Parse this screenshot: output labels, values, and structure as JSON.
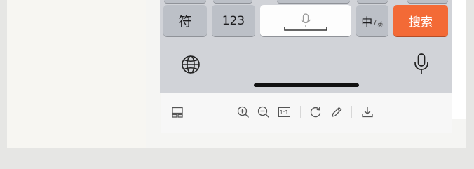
{
  "keyboard": {
    "symbol_key": "符",
    "number_key": "123",
    "lang_main": "中",
    "lang_sep": "/",
    "lang_alt": "英",
    "search_key": "搜索"
  },
  "icons": {
    "globe": "globe-icon",
    "mic": "microphone-icon",
    "space_mic": "microphone-icon"
  },
  "toolbar": {
    "ratio_label": "1:1",
    "icons": [
      "layout-icon",
      "zoom-in-icon",
      "zoom-out-icon",
      "actual-size-icon",
      "rotate-icon",
      "edit-icon",
      "download-icon"
    ]
  },
  "colors": {
    "search_key": "#f36a36",
    "keyboard_bg": "#d1d3d8"
  }
}
